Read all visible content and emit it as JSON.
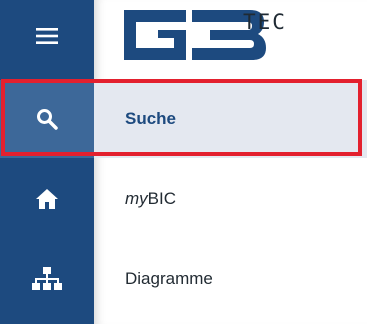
{
  "brand": {
    "logo_text": "GB",
    "tec_label": "TEC",
    "primary_color": "#1d4a7f"
  },
  "rail": {
    "items": [
      {
        "icon": "hamburger-menu-icon"
      },
      {
        "icon": "search-icon"
      },
      {
        "icon": "home-icon"
      },
      {
        "icon": "org-chart-icon"
      }
    ]
  },
  "nav": {
    "items": [
      {
        "label": "Suche",
        "active": true
      },
      {
        "prefix": "my",
        "label": "BIC"
      },
      {
        "label": "Diagramme"
      }
    ]
  },
  "highlight": {
    "color": "#e3202e"
  }
}
